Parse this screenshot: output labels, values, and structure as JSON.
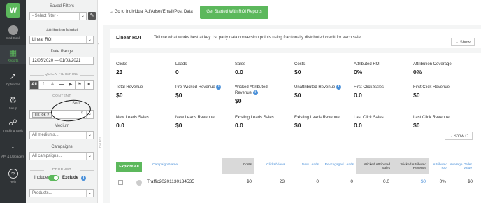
{
  "rail": {
    "logo": "W",
    "items": [
      {
        "label": "Brad Cook",
        "icon": "avatar-icon"
      },
      {
        "label": "Reports",
        "icon": "chart-icon"
      },
      {
        "label": "Optimizer",
        "icon": "trend-icon"
      },
      {
        "label": "Setup",
        "icon": "gear-icon"
      },
      {
        "label": "Tracking Tools",
        "icon": "share-icon"
      },
      {
        "label": "API & Uploaders",
        "icon": "upload-icon"
      },
      {
        "label": "Help",
        "icon": "help-icon"
      }
    ]
  },
  "panel": {
    "saved_filters_label": "Saved Filters",
    "saved_filters_placeholder": "- Select filter -",
    "attribution_label": "Attribution Model",
    "attribution_value": "Linear ROI",
    "date_label": "Date Range",
    "date_value": "12/05/2020 — 01/03/2021",
    "quick_filtering_label": "QUICK FILTERING",
    "quick_filters": [
      "All",
      "f",
      "A",
      "▬",
      "▶",
      "⚑",
      "■"
    ],
    "content_label": "CONTENT",
    "source_label": "Sou",
    "source_chip": "TikTok",
    "medium_label": "Medium",
    "medium_placeholder": "All mediums...",
    "campaigns_label": "Campaigns",
    "campaigns_placeholder": "All campaigns...",
    "product_label": "PRODUCT",
    "include_label": "Include",
    "exclude_label": "Exclude",
    "products_placeholder": "Products...",
    "filters_tab": "FILTERS"
  },
  "topbar": {
    "goto_text": "→ Go to Individual Ad/Adset/Email/Post Data",
    "roi_button": "Get Started With ROI Reports"
  },
  "header": {
    "title": "Linear ROI",
    "description": "Tell me what works best at key 1st party data conversion points using fractionally distributed credit for each sale.",
    "show_label": "Show"
  },
  "metrics": [
    {
      "label": "Clicks",
      "value": "23"
    },
    {
      "label": "Leads",
      "value": "0"
    },
    {
      "label": "Sales",
      "value": "0.0"
    },
    {
      "label": "Costs",
      "value": "$0"
    },
    {
      "label": "Attributed ROI",
      "value": "0%"
    },
    {
      "label": "Attribution Coverage",
      "value": "0%"
    },
    {
      "label": "Total Revenue",
      "value": "$0"
    },
    {
      "label": "Pre-Wicked Revenue",
      "value": "$0"
    },
    {
      "label": "Wicked Attributed Revenue",
      "value": "$0"
    },
    {
      "label": "Unattributed Revenue",
      "value": "$0"
    },
    {
      "label": "First Click Sales",
      "value": "0.0"
    },
    {
      "label": "First Click Revenue",
      "value": "$0"
    },
    {
      "label": "New Leads Sales",
      "value": "0.0"
    },
    {
      "label": "New Leads Revenue",
      "value": "$0"
    },
    {
      "label": "Existing Leads Sales",
      "value": "0.0"
    },
    {
      "label": "Existing Leads Revenue",
      "value": "$0"
    },
    {
      "label": "Last Click Sales",
      "value": "0.0"
    },
    {
      "label": "Last Click Revenue",
      "value": "$0"
    }
  ],
  "show_bottom": "Show C",
  "table": {
    "explore_label": "Explore All",
    "headers": [
      "Campaign Name",
      "Costs",
      "Clicks/Views",
      "New Leads",
      "Re-Engaged Leads",
      "Wicked Attributed Sales",
      "Wicked Attributed Revenue",
      "Attributed ROI",
      "Average Order Value"
    ],
    "row": {
      "name": "Traffic20201130134535",
      "costs": "$0",
      "clicks": "23",
      "new_leads": "0",
      "reengaged": "0",
      "sales": "0.0",
      "revenue": "$0",
      "roi": "0%",
      "aov": "$0"
    }
  }
}
